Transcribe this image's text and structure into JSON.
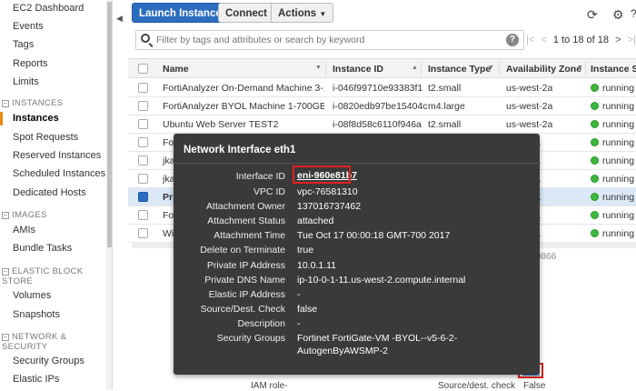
{
  "sidebar": {
    "items": [
      {
        "label": "EC2 Dashboard"
      },
      {
        "label": "Events"
      },
      {
        "label": "Tags"
      },
      {
        "label": "Reports"
      },
      {
        "label": "Limits"
      }
    ],
    "sections": [
      {
        "label": "INSTANCES"
      },
      {
        "label": "IMAGES"
      },
      {
        "label": "ELASTIC BLOCK STORE"
      },
      {
        "label": "NETWORK & SECURITY"
      }
    ],
    "instances_items": [
      "Instances",
      "Spot Requests",
      "Reserved Instances",
      "Scheduled Instances",
      "Dedicated Hosts"
    ],
    "images_items": [
      "AMIs",
      "Bundle Tasks"
    ],
    "ebs_items": [
      "Volumes",
      "Snapshots"
    ],
    "network_items": [
      "Security Groups",
      "Elastic IPs"
    ]
  },
  "toolbar": {
    "launch_label": "Launch Instance",
    "connect_label": "Connect",
    "actions_label": "Actions"
  },
  "search": {
    "placeholder": "Filter by tags and attributes or search by keyword"
  },
  "pager": {
    "text": "1 to 18 of 18"
  },
  "table": {
    "columns": [
      "Name",
      "Instance ID",
      "Instance Type",
      "Availability Zone",
      "Instance St"
    ],
    "rows": [
      {
        "name": "FortiAnalyzer On-Demand Machine 3-1",
        "id": "i-046f99710e93383f1",
        "type": "t2.small",
        "az": "us-west-2a",
        "state": "running"
      },
      {
        "name": "FortiAnalyzer BYOL Machine 1-700GB-...",
        "id": "i-0820edb97be15404c",
        "type": "m4.large",
        "az": "us-west-2a",
        "state": "running"
      },
      {
        "name": "Ubuntu Web Server TEST2",
        "id": "i-08f8d58c6110f946a",
        "type": "t2.small",
        "az": "us-west-2a",
        "state": "running"
      },
      {
        "name": "Fo",
        "id": "",
        "type": "",
        "az": "a",
        "state": "running"
      },
      {
        "name": "jka",
        "id": "",
        "type": "",
        "az": "a",
        "state": "running"
      },
      {
        "name": "jka",
        "id": "",
        "type": "",
        "az": "a",
        "state": "running"
      },
      {
        "name": "Pri",
        "id": "",
        "type": "",
        "az": "a",
        "state": "running"
      },
      {
        "name": "Fo",
        "id": "",
        "type": "",
        "az": "a",
        "state": "running"
      },
      {
        "name": "Wi",
        "id": "",
        "type": "",
        "az": "a",
        "state": "running"
      }
    ]
  },
  "popup": {
    "title": "Network Interface eth1",
    "fields": [
      {
        "label": "Interface ID",
        "value": "eni-960e81b7"
      },
      {
        "label": "VPC ID",
        "value": "vpc-76581310"
      },
      {
        "label": "Attachment Owner",
        "value": "137016737462"
      },
      {
        "label": "Attachment Status",
        "value": "attached"
      },
      {
        "label": "Attachment Time",
        "value": "Tue Oct 17 00:00:18 GMT-700 2017"
      },
      {
        "label": "Delete on Terminate",
        "value": "true"
      },
      {
        "label": "Private IP Address",
        "value": "10.0.1.11"
      },
      {
        "label": "Private DNS Name",
        "value": "ip-10-0-1-11.us-west-2.compute.internal"
      },
      {
        "label": "Elastic IP Address",
        "value": "-"
      },
      {
        "label": "Source/Dest. Check",
        "value": "false"
      },
      {
        "label": "Description",
        "value": "-"
      },
      {
        "label": "Security Groups",
        "value": "Fortinet FortiGate-VM -BYOL--v5-6-2-"
      },
      {
        "label": "",
        "value": "AutogenByAWSMP-2"
      }
    ]
  },
  "details": {
    "iam_label": "IAM role",
    "iam_value": "-",
    "srcdest_label": "Source/dest. check",
    "srcdest_value": "False",
    "eth1_link": "eth1",
    "partial_id": "et-00960866"
  }
}
